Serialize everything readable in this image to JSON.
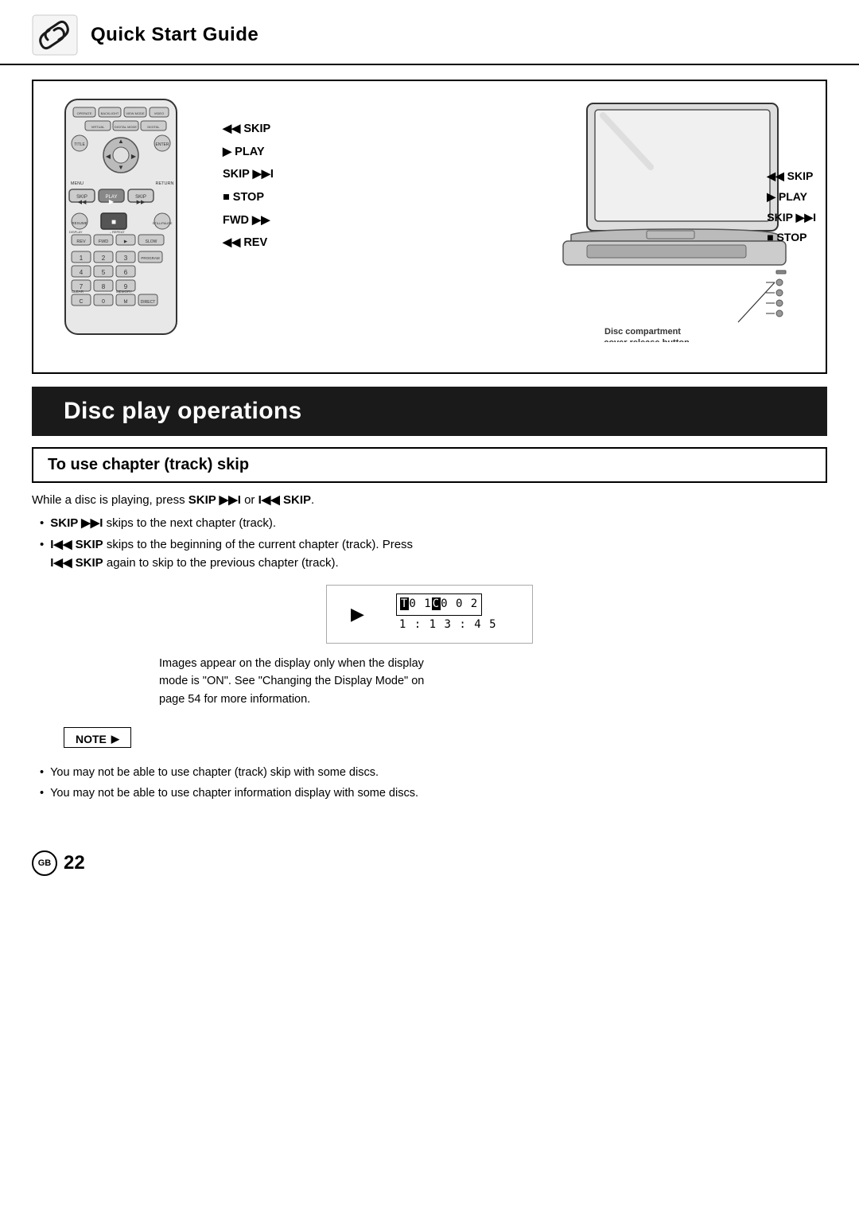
{
  "header": {
    "title": "Quick Start Guide",
    "logo_alt": "brand-logo"
  },
  "diagram": {
    "left_labels": [
      {
        "icon": "◀◀",
        "text": " SKIP"
      },
      {
        "icon": "▶",
        "text": " PLAY"
      },
      {
        "icon": "",
        "text": "SKIP ▶▶I"
      },
      {
        "icon": "■",
        "text": " STOP"
      },
      {
        "icon": "",
        "text": "FWD ▶▶"
      },
      {
        "icon": "◀◀",
        "text": " REV"
      }
    ],
    "right_labels": [
      {
        "icon": "◀◀",
        "text": " SKIP"
      },
      {
        "icon": "▶",
        "text": " PLAY"
      },
      {
        "icon": "",
        "text": "SKIP ▶▶I"
      },
      {
        "icon": "■",
        "text": " STOP"
      }
    ],
    "disc_label_line1": "Disc compartment",
    "disc_label_line2": "cover release button"
  },
  "section": {
    "title": "Disc play operations"
  },
  "subsection": {
    "title": "To use chapter (track) skip"
  },
  "body": {
    "intro": "While a disc is playing, press SKIP ▶▶I or I◀◀ SKIP.",
    "bullet1_prefix": "SKIP ▶▶I",
    "bullet1_suffix": " skips to the next chapter (track).",
    "bullet2_prefix": "I◀◀ SKIP",
    "bullet2_mid": " skips to the beginning of the current chapter (track). Press",
    "bullet2_prefix2": "I◀◀ SKIP",
    "bullet2_suffix": " again to skip to the previous chapter (track)."
  },
  "display": {
    "play_icon": "▶",
    "top_row_pre": "",
    "top_row": "T01C002",
    "highlight_chars": [
      "T",
      "C"
    ],
    "bottom_row": "1 : 1 3 : 4 5"
  },
  "caption": {
    "line1": "Images appear on the display only when the display",
    "line2": "mode is \"ON\". See \"Changing the Display Mode\" on",
    "line3": "page 54 for more information."
  },
  "note": {
    "label": "NOTE",
    "arrow": "▶",
    "bullets": [
      "You may not be able to use chapter (track) skip with some discs.",
      "You may not be able to use chapter information display with some discs."
    ]
  },
  "footer": {
    "badge": "GB",
    "page_number": "22"
  }
}
